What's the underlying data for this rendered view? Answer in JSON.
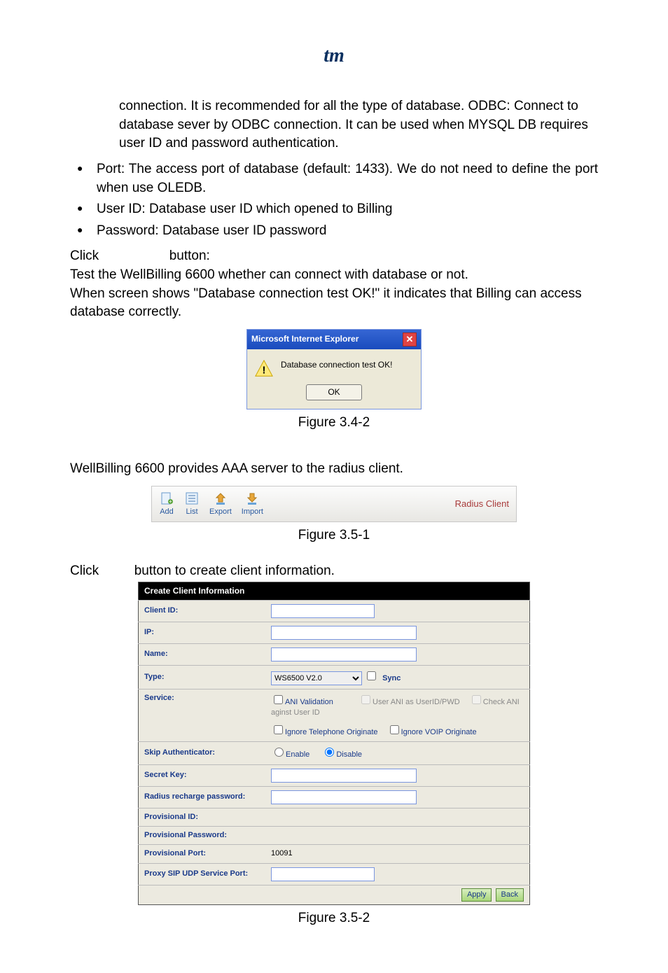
{
  "logo_text": "tm",
  "para1": "connection. It is recommended for all the type of database. ODBC: Connect to database sever by ODBC connection. It can be used when MYSQL DB requires user ID and password authentication.",
  "bullets": [
    "Port: The access port of database (default: 1433). We do not need to define the port when use OLEDB.",
    "User ID: Database user ID which opened to Billing",
    "Password: Database user ID password"
  ],
  "click_line_prefix": "Click",
  "click_line_suffix": "button:",
  "para2a": "Test the WellBilling 6600 whether can connect with database or not.",
  "para2b": "When screen shows \"Database connection test OK!\" it indicates that Billing can access database correctly.",
  "dialog": {
    "title": "Microsoft Internet Explorer",
    "message": "Database connection test OK!",
    "ok": "OK"
  },
  "fig342": "Figure 3.4-2",
  "para3": "WellBilling 6600 provides AAA server to the radius client.",
  "toolbar": {
    "add": "Add",
    "list": "List",
    "export": "Export",
    "import": "Import",
    "title": "Radius Client"
  },
  "fig351": "Figure 3.5-1",
  "click2_prefix": "Click",
  "click2_suffix": "button to create client information.",
  "form": {
    "header": "Create Client Information",
    "client_id": "Client ID:",
    "ip": "IP:",
    "name": "Name:",
    "type": "Type:",
    "type_option": "WS6500 V2.0",
    "sync": "Sync",
    "service": "Service:",
    "ani_validation": "ANI Validation",
    "user_ani": "User ANI as UserID/PWD",
    "check_ani": "Check ANI aginst User ID",
    "ignore_tele": "Ignore Telephone Originate",
    "ignore_voip": "Ignore VOIP Originate",
    "skip_auth": "Skip Authenticator:",
    "enable": "Enable",
    "disable": "Disable",
    "secret_key": "Secret Key:",
    "radius_recharge": "Radius recharge password:",
    "prov_id": "Provisional ID:",
    "prov_pwd": "Provisional Password:",
    "prov_port": "Provisional Port:",
    "prov_port_val": "10091",
    "proxy_sip": "Proxy SIP UDP Service Port:",
    "apply": "Apply",
    "back": "Back"
  },
  "fig352": "Figure 3.5-2"
}
